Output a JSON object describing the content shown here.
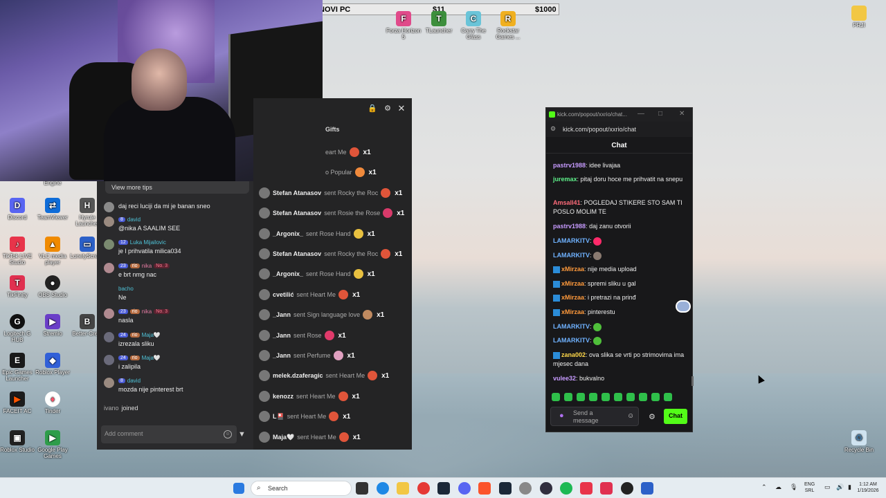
{
  "overlay": {
    "label": "NOVI PC",
    "value1": "$11",
    "value2": "$1000"
  },
  "desktop_icons": {
    "forza": "Forza Horizon 5",
    "tlauncher": "TLauncher",
    "carry": "Carry The Glass",
    "rockstar": "Rockstar Games ...",
    "prj": "PRJI",
    "engine": "Engine",
    "discord": "Discord",
    "teamviewer": "TeamViewer",
    "hyrule": "Hyrule Launcher",
    "tiktok_live": "TikTok LIVE Studio",
    "vlc": "VLC media player",
    "lonely": "LonelyScreen",
    "tikfinity": "TikFinity",
    "obs": "OBS Studio",
    "logitech": "Logitech G HUB",
    "stremio": "Stremio",
    "better": "Better-Cre...",
    "epic": "Epic Games Launcher",
    "roblox_player": "Roblox Player",
    "faceit": "FACEIT AC",
    "tinder": "Tinder",
    "roblox_studio": "Roblox Studio",
    "google_play": "Google Play Games",
    "recycle": "Recycle Bin"
  },
  "tiktok": {
    "view_tips": "View more tips",
    "gifts_tab": "Gifts",
    "add_comment_placeholder": "Add comment",
    "comments": [
      {
        "user": "",
        "level": "",
        "text": "daj reci luciji da mi je banan sneo"
      },
      {
        "user": "david",
        "level": "8",
        "text": "@nika A SAALIM SEE"
      },
      {
        "user": "Luka Mijailovic",
        "level": "12",
        "text": "je l prihvatila milica034"
      },
      {
        "user": "nika",
        "level": "23",
        "fan": "rio",
        "rank": "No. 3",
        "text": "e brt nmg nac"
      },
      {
        "user": "bacho",
        "level": "",
        "text": "Ne"
      },
      {
        "user": "nika",
        "level": "23",
        "fan": "rio",
        "rank": "No. 3",
        "text": "nasla"
      },
      {
        "user": "Maja🤍",
        "level": "24",
        "fan": "rio",
        "text": "izrezala sliku"
      },
      {
        "user": "Maja🤍",
        "level": "24",
        "fan": "rio",
        "text": "i zalipila"
      },
      {
        "user": "david",
        "level": "8",
        "text": "mozda nije pinterest brt"
      }
    ],
    "joined": {
      "user": "ivano",
      "text": "joined"
    },
    "gifts": [
      {
        "name": "",
        "action": "eart Me",
        "count": "x1"
      },
      {
        "name": "",
        "action": "o Popular",
        "count": "x1"
      },
      {
        "name": "Stefan Atanasov",
        "action": "sent Rocky the Roc",
        "count": "x1"
      },
      {
        "name": "Stefan Atanasov",
        "action": "sent Rosie the Rose",
        "count": "x1"
      },
      {
        "name": "_Argonix_",
        "action": "sent Rose Hand",
        "count": "x1"
      },
      {
        "name": "Stefan Atanasov",
        "action": "sent Rocky the Roc",
        "count": "x1"
      },
      {
        "name": "_Argonix_",
        "action": "sent Rose Hand",
        "count": "x1"
      },
      {
        "name": "cvetilić",
        "action": "sent Heart Me",
        "count": "x1"
      },
      {
        "name": "_Jann",
        "action": "sent Sign language love",
        "count": "x1"
      },
      {
        "name": "_Jann",
        "action": "sent Rose",
        "count": "x1"
      },
      {
        "name": "_Jann",
        "action": "sent Perfume",
        "count": "x1"
      },
      {
        "name": "melek.dzaferagic",
        "action": "sent Heart Me",
        "count": "x1"
      },
      {
        "name": "kenozz",
        "action": "sent Heart Me",
        "count": "x1"
      },
      {
        "name": "L🎴",
        "action": "sent Heart Me",
        "count": "x1"
      },
      {
        "name": "Maja🤍",
        "action": "sent Heart Me",
        "count": "x1"
      }
    ]
  },
  "kick": {
    "window_title": "kick.com/popout/xxrio/chat...",
    "url": "kick.com/popout/xxrio/chat",
    "header": "Chat",
    "input_placeholder": "Send a message",
    "chat_button": "Chat",
    "messages": [
      {
        "user": "pastrv1988",
        "color": "#c79bff",
        "text": "idee livajaa"
      },
      {
        "user": "juremax",
        "color": "#5ef08a",
        "text": "pitaj doru hoce me prihvatit na snepu"
      },
      {
        "user": "Amsall41",
        "color": "#ff6b7a",
        "text": "POGLEDAJ STIKERE STO SAM TI POSLO MOLIM TE"
      },
      {
        "user": "pastrv1988",
        "color": "#c79bff",
        "text": "daj zanu otvorii"
      },
      {
        "user": "LAMARKITV",
        "color": "#6fb2ff",
        "text": ""
      },
      {
        "user": "LAMARKITV",
        "color": "#6fb2ff",
        "text": ""
      },
      {
        "user": "xMirzaa",
        "color": "#ff9a3c",
        "text": "nije media upload"
      },
      {
        "user": "xMirzaa",
        "color": "#ff9a3c",
        "text": "spremi sliku u gal"
      },
      {
        "user": "xMirzaa",
        "color": "#ff9a3c",
        "text": "i pretrazi na prinđ"
      },
      {
        "user": "xMirzaa",
        "color": "#ff9a3c",
        "text": "pinterestu"
      },
      {
        "user": "LAMARKITV",
        "color": "#6fb2ff",
        "text": ""
      },
      {
        "user": "LAMARKITV",
        "color": "#6fb2ff",
        "text": ""
      },
      {
        "user": "zana002",
        "color": "#ffd84a",
        "text": "ova slika se vrti po strimovima ima mjesec dana"
      },
      {
        "user": "vulee32",
        "color": "#c79bff",
        "text": "bukvalno"
      }
    ]
  },
  "taskbar": {
    "search_placeholder": "Search",
    "lang1": "ENG",
    "lang2": "SRL",
    "time": "1:12 AM",
    "date": "1/19/2026"
  }
}
